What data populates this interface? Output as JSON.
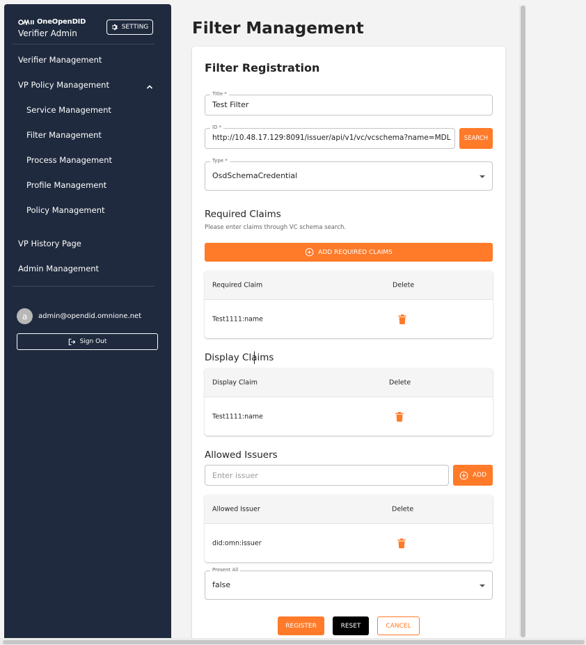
{
  "sidebar": {
    "brand_logo": "OneOpenDID",
    "brand_title": "Verifier Admin",
    "setting_label": "SETTING",
    "nav": {
      "verifier_management": "Verifier Management",
      "vp_policy_management": "VP Policy Management",
      "service_management": "Service Management",
      "filter_management": "Filter Management",
      "process_management": "Process Management",
      "profile_management": "Profile Management",
      "policy_management": "Policy Management",
      "vp_history_page": "VP History Page",
      "admin_management": "Admin Management"
    },
    "user": {
      "avatar_letter": "a",
      "email": "admin@opendid.omnione.net",
      "sign_out": "Sign Out"
    }
  },
  "main": {
    "page_title": "Filter Management",
    "card_title": "Filter Registration",
    "title_field": {
      "label": "Title *",
      "value": "Test Filter"
    },
    "id_field": {
      "label": "ID *",
      "value": "http://10.48.17.129:8091/issuer/api/v1/vc/vcschema?name=MDL"
    },
    "search_label": "SEARCH",
    "type_field": {
      "label": "Type *",
      "value": "OsdSchemaCredential"
    },
    "required_claims": {
      "title": "Required Claims",
      "subtitle": "Please enter claims through VC schema search.",
      "add_button": "ADD REQUIRED CLAIMS",
      "col_claim": "Required Claim",
      "col_delete": "Delete",
      "rows": [
        {
          "claim": "Test1111:name"
        }
      ]
    },
    "display_claims": {
      "title": "Display Claims",
      "col_claim": "Display Claim",
      "col_delete": "Delete",
      "rows": [
        {
          "claim": "Test1111:name"
        }
      ]
    },
    "allowed_issuers": {
      "title": "Allowed Issuers",
      "input_placeholder": "Enter issuer",
      "add_button": "ADD",
      "col_issuer": "Allowed Issuer",
      "col_delete": "Delete",
      "rows": [
        {
          "issuer": "did:omn:issuer"
        }
      ]
    },
    "present_all": {
      "label": "Present All",
      "value": "false"
    },
    "actions": {
      "register": "REGISTER",
      "reset": "RESET",
      "cancel": "CANCEL"
    }
  },
  "colors": {
    "sidebar_bg": "#1f2a3e",
    "accent": "#ff7a29",
    "reset_bg": "#000000"
  }
}
